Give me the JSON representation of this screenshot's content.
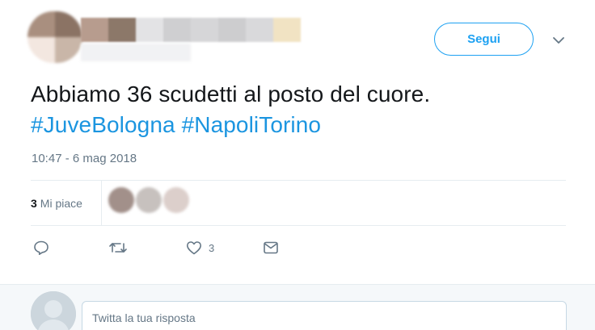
{
  "author": {
    "avatar_colors": [
      "#a98f7f",
      "#8b7364",
      "#f3e7e0",
      "#c9b6a8"
    ],
    "name_redaction_colors": [
      "#b79c8e",
      "#8c7869",
      "#e3e3e5",
      "#cfcfd1",
      "#d6d6d8",
      "#cdcdcf",
      "#d9d9db",
      "#f1e3c3"
    ]
  },
  "follow_button": {
    "label": "Segui",
    "color": "#1da1f2"
  },
  "tweet": {
    "text": "Abbiamo 36 scudetti al posto del cuore.",
    "hashtags": [
      "#JuveBologna",
      "#NapoliTorino"
    ],
    "hashtag_color": "#1b95e0",
    "timestamp": "10:47 - 6 mag 2018"
  },
  "stats": {
    "likes_count": "3",
    "likes_label": "Mi piace",
    "liker_avatar_colors": [
      "#a2908a",
      "#c7c1be",
      "#dccfcb"
    ]
  },
  "actions": [
    {
      "name": "reply",
      "icon": "reply-icon",
      "count": ""
    },
    {
      "name": "retweet",
      "icon": "retweet-icon",
      "count": ""
    },
    {
      "name": "like",
      "icon": "heart-icon",
      "count": "3"
    },
    {
      "name": "message",
      "icon": "envelope-icon",
      "count": ""
    }
  ],
  "reply": {
    "placeholder": "Twitta la tua risposta"
  }
}
